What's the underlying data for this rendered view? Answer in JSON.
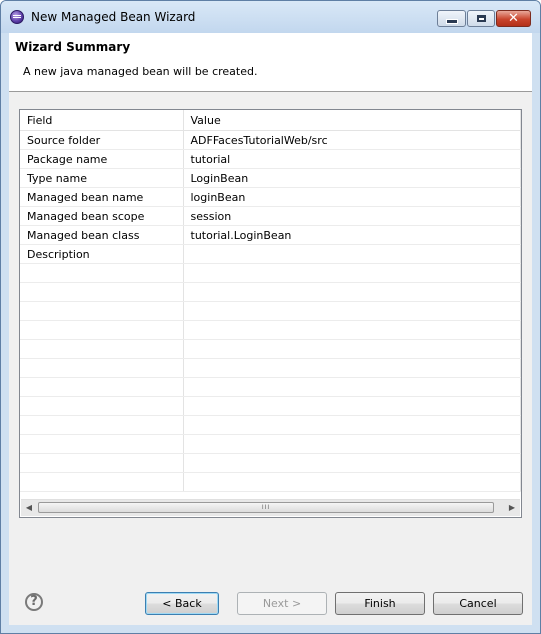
{
  "window": {
    "title": "New Managed Bean Wizard"
  },
  "header": {
    "title": "Wizard Summary",
    "message": "A new java managed bean will be created."
  },
  "table": {
    "columns": [
      "Field",
      "Value"
    ],
    "rows": [
      [
        "Source folder",
        "ADFFacesTutorialWeb/src"
      ],
      [
        "Package name",
        "tutorial"
      ],
      [
        "Type name",
        "LoginBean"
      ],
      [
        "Managed bean name",
        "loginBean"
      ],
      [
        "Managed bean scope",
        "session"
      ],
      [
        "Managed bean class",
        "tutorial.LoginBean"
      ],
      [
        "Description",
        ""
      ]
    ],
    "empty_rows": 12,
    "scroll_thumb_grip": "III"
  },
  "buttons": {
    "help": "?",
    "back": "< Back",
    "next": "Next >",
    "finish": "Finish",
    "cancel": "Cancel"
  },
  "icons": {
    "app": "eclipse-icon",
    "minimize": "minimize-icon",
    "maximize": "maximize-icon",
    "close": "close-icon",
    "scroll_left": "arrow-left-icon",
    "scroll_right": "arrow-right-icon"
  }
}
